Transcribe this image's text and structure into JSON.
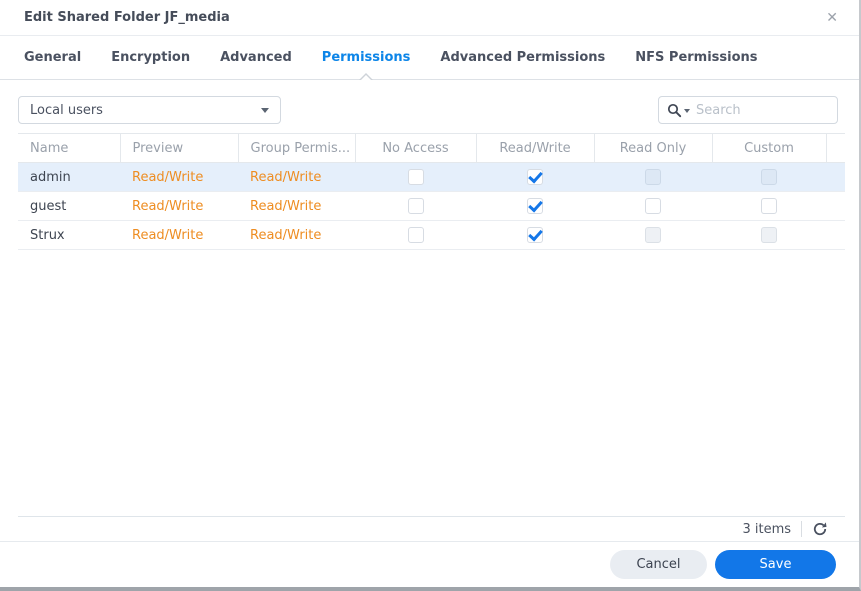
{
  "dialog": {
    "title": "Edit Shared Folder JF_media",
    "close_glyph": "✕"
  },
  "tabs": [
    {
      "label": "General",
      "active": false
    },
    {
      "label": "Encryption",
      "active": false
    },
    {
      "label": "Advanced",
      "active": false
    },
    {
      "label": "Permissions",
      "active": true
    },
    {
      "label": "Advanced Permissions",
      "active": false
    },
    {
      "label": "NFS Permissions",
      "active": false
    }
  ],
  "toolbar": {
    "filter_dropdown": {
      "value": "Local users",
      "icon": "chevron-down-icon"
    },
    "search": {
      "placeholder": "Search",
      "icon": "magnifier-with-caret-icon"
    }
  },
  "table": {
    "columns": [
      {
        "label": "Name"
      },
      {
        "label": "Preview"
      },
      {
        "label": "Group Permis..."
      },
      {
        "label": "No Access"
      },
      {
        "label": "Read/Write"
      },
      {
        "label": "Read Only"
      },
      {
        "label": "Custom"
      }
    ],
    "rows": [
      {
        "name": "admin",
        "preview": "Read/Write",
        "group_permission": "Read/Write",
        "no_access": "unchecked",
        "read_write": "checked",
        "read_only": "disabled",
        "custom": "disabled",
        "selected": true
      },
      {
        "name": "guest",
        "preview": "Read/Write",
        "group_permission": "Read/Write",
        "no_access": "unchecked",
        "read_write": "checked",
        "read_only": "unchecked",
        "custom": "unchecked",
        "selected": false
      },
      {
        "name": "Strux",
        "preview": "Read/Write",
        "group_permission": "Read/Write",
        "no_access": "unchecked",
        "read_write": "checked",
        "read_only": "disabled",
        "custom": "disabled",
        "selected": false
      }
    ]
  },
  "footer": {
    "items_count": "3 items",
    "refresh_icon": "refresh-icon"
  },
  "actions": {
    "cancel_label": "Cancel",
    "save_label": "Save"
  },
  "colors": {
    "accent_blue": "#0c85e8",
    "check_blue": "#1577e8",
    "orange_permission": "#ee8d22",
    "row_highlight": "#e5effb",
    "save_button": "#1277e8"
  }
}
